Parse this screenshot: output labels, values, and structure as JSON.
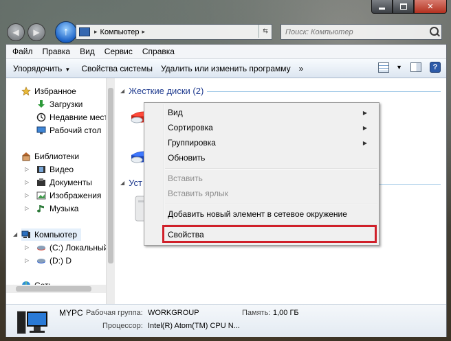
{
  "address": {
    "crumb": "Компьютер"
  },
  "search": {
    "placeholder": "Поиск: Компьютер"
  },
  "menu": [
    "Файл",
    "Правка",
    "Вид",
    "Сервис",
    "Справка"
  ],
  "toolbar": {
    "organize": "Упорядочить",
    "system_props": "Свойства системы",
    "uninstall": "Удалить или изменить программу",
    "more": "»"
  },
  "sidebar": {
    "favorites": "Избранное",
    "downloads": "Загрузки",
    "recent": "Недавние мест",
    "desktop": "Рабочий стол",
    "libraries": "Библиотеки",
    "video": "Видео",
    "documents": "Документы",
    "images": "Изображения",
    "music": "Музыка",
    "computer": "Компьютер",
    "drive_c": "(C:) Локальный",
    "drive_d": "(D:) D",
    "network": "Сеть"
  },
  "content": {
    "hard_disks": "Жесткие диски (2)",
    "removable_partial": "Уст"
  },
  "context_menu": {
    "view": "Вид",
    "sort": "Сортировка",
    "group": "Группировка",
    "refresh": "Обновить",
    "paste": "Вставить",
    "paste_shortcut": "Вставить ярлык",
    "add_network": "Добавить новый элемент в сетевое окружение",
    "properties": "Свойства"
  },
  "details": {
    "name": "MYPC",
    "workgroup_label": "Рабочая группа:",
    "workgroup_value": "WORKGROUP",
    "memory_label": "Память:",
    "memory_value": "1,00 ГБ",
    "cpu_label": "Процессор:",
    "cpu_value": "Intel(R) Atom(TM) CPU N..."
  }
}
